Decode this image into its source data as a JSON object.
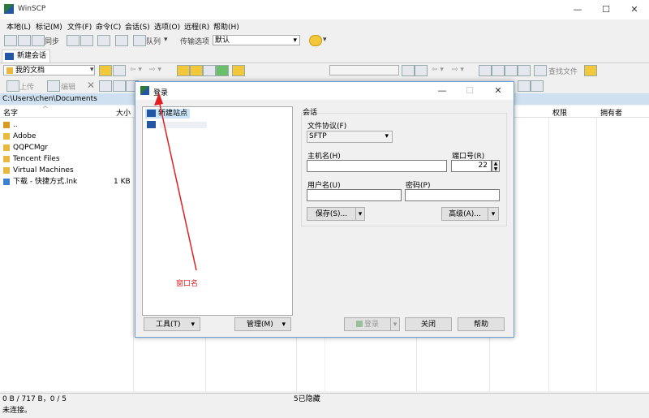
{
  "app": {
    "title": "WinSCP",
    "minimize": "—",
    "maximize": "☐",
    "close": "✕"
  },
  "menu": [
    "本地(L)",
    "标记(M)",
    "文件(F)",
    "命令(C)",
    "会话(S)",
    "选项(O)",
    "远程(R)",
    "帮助(H)"
  ],
  "toolbar": {
    "sync": "同步",
    "queue": "队列",
    "transfer_options": "传输选项",
    "transfer_default": "默认"
  },
  "tab": {
    "new_session": "新建会话"
  },
  "local": {
    "location": "我的文档",
    "upload": "上传",
    "edit": "编辑",
    "path": "C:\\Users\\chen\\Documents",
    "columns": {
      "name": "名字",
      "size": "大小"
    },
    "files": [
      {
        "name": "..",
        "size": ""
      },
      {
        "name": "Adobe",
        "size": ""
      },
      {
        "name": "QQPCMgr",
        "size": ""
      },
      {
        "name": "Tencent Files",
        "size": ""
      },
      {
        "name": "Virtual Machines",
        "size": ""
      },
      {
        "name": "下载 - 快捷方式.lnk",
        "size": "1 KB"
      }
    ]
  },
  "remote": {
    "find_files": "查找文件",
    "columns": {
      "permissions": "权限",
      "owner": "拥有者"
    }
  },
  "status": {
    "left": "0 B / 717 B，0 / 5",
    "hidden": "5已隐藏",
    "connection": "未连接。"
  },
  "dialog": {
    "title": "登录",
    "site_new": "新建站点",
    "group_label": "会话",
    "protocol_label": "文件协议(F)",
    "protocol_value": "SFTP",
    "host_label": "主机名(H)",
    "host_value": "",
    "port_label": "端口号(R)",
    "port_value": "22",
    "user_label": "用户名(U)",
    "user_value": "",
    "password_label": "密码(P)",
    "password_value": "",
    "save_btn": "保存(S)...",
    "advanced_btn": "高级(A)...",
    "tools_btn": "工具(T)",
    "manage_btn": "管理(M)",
    "login_btn": "登录",
    "close_btn": "关闭",
    "help_btn": "帮助"
  },
  "annotation": {
    "text": "窗口名",
    "color": "#e02020"
  }
}
